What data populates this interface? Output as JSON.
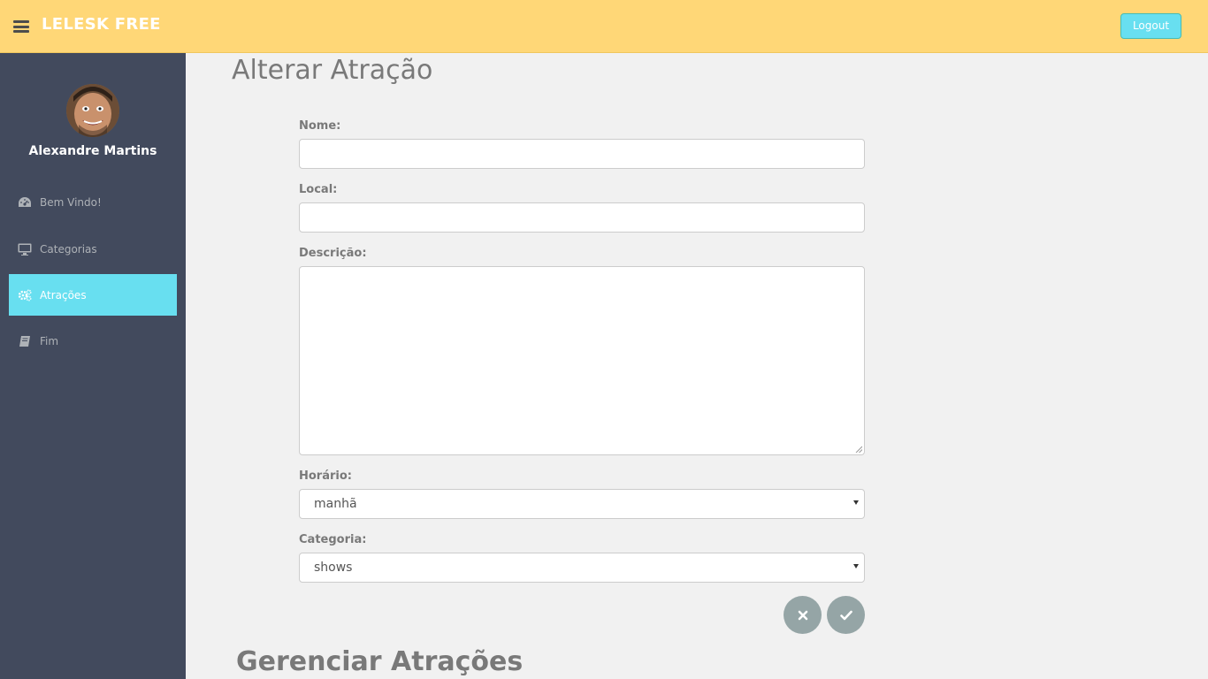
{
  "header": {
    "brand": "LELESK FREE",
    "logout_label": "Logout",
    "accent_color": "#ffd777"
  },
  "sidebar": {
    "user_name": "Alexandre Martins",
    "items": [
      {
        "label": "Bem Vindo!",
        "icon": "dashboard-icon"
      },
      {
        "label": "Categorias",
        "icon": "desktop-icon"
      },
      {
        "label": "Atrações",
        "icon": "cogs-icon",
        "active": true
      },
      {
        "label": "Fim",
        "icon": "book-icon"
      }
    ],
    "active_color": "#68dff0"
  },
  "main": {
    "title": "Alterar Atração",
    "form": {
      "nome_label": "Nome:",
      "nome_value": "",
      "local_label": "Local:",
      "local_value": "",
      "descricao_label": "Descrição:",
      "descricao_value": "",
      "horario_label": "Horário:",
      "horario_value": "manhã",
      "categoria_label": "Categoria:",
      "categoria_value": "shows"
    },
    "buttons": {
      "cancel_icon": "times-icon",
      "confirm_icon": "check-icon"
    },
    "section_title": "Gerenciar Atrações"
  }
}
